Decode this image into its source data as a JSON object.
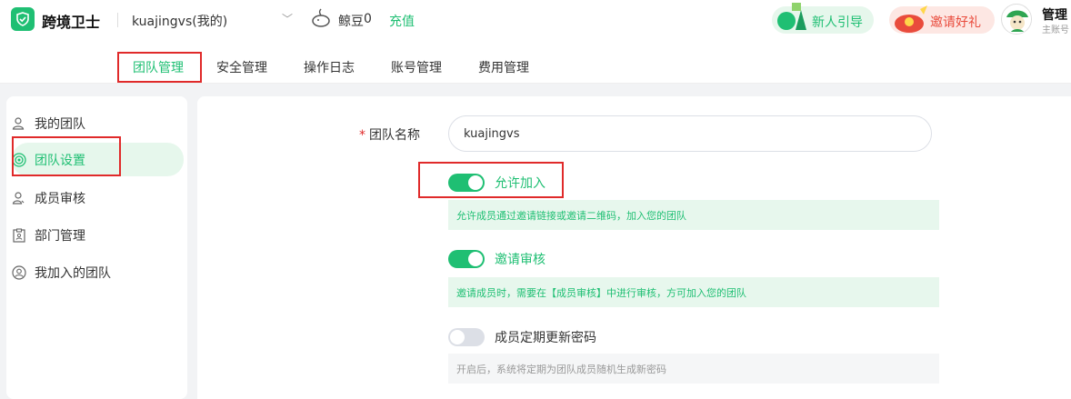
{
  "header": {
    "app_name": "跨境卫士",
    "account": "kuajingvs(我的)",
    "bean_label": "鲸豆",
    "bean_count": "0",
    "recharge": "充值",
    "new_guide": "新人引导",
    "invite_gift": "邀请好礼",
    "admin_name": "管理",
    "admin_sub": "主账号"
  },
  "tabs": [
    "团队管理",
    "安全管理",
    "操作日志",
    "账号管理",
    "费用管理"
  ],
  "sidebar": {
    "items": [
      {
        "label": "我的团队",
        "icon": "user-icon"
      },
      {
        "label": "团队设置",
        "icon": "target-icon"
      },
      {
        "label": "成员审核",
        "icon": "user-check-icon"
      },
      {
        "label": "部门管理",
        "icon": "clipboard-icon"
      },
      {
        "label": "我加入的团队",
        "icon": "user-circle-icon"
      }
    ]
  },
  "form": {
    "team_name_label": "团队名称",
    "team_name_value": "kuajingvs",
    "allow_join_label": "允许加入",
    "allow_join_hint": "允许成员通过邀请链接或邀请二维码，加入您的团队",
    "invite_review_label": "邀请审核",
    "invite_review_hint": "邀请成员时，需要在【成员审核】中进行审核，方可加入您的团队",
    "password_label": "成员定期更新密码",
    "password_hint": "开启后，系统将定期为团队成员随机生成新密码"
  },
  "switches": {
    "allow_join": true,
    "invite_review": true,
    "password_rotate": false
  },
  "colors": {
    "accent": "#1fbf73",
    "highlight_box": "#e02a2a",
    "invite": "#e94b3c"
  }
}
